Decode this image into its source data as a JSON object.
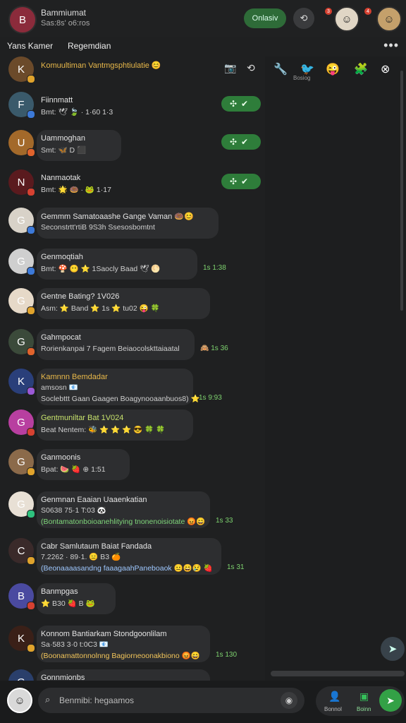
{
  "header": {
    "name": "Bammiumat",
    "subtitle": "Sas:8s' o6:ros",
    "online_label": "Onlasiv",
    "refresh_icon": "refresh-icon",
    "avatar_initial": "B"
  },
  "subbar": {
    "tab1": "Yans Kamer",
    "tab2": "Regemdian",
    "more_label": "•••"
  },
  "right_panel": {
    "label": "Bosiog"
  },
  "rows": [
    {
      "name": "Komuultiman Vantmgsphtiulatie 😊",
      "msg": "",
      "time": "",
      "name_color": "orange",
      "initial": "K",
      "avatar": "#6b4a2a",
      "badge": "#e0a32c"
    },
    {
      "name": "Fiinnmatt",
      "msg": "Bmt: 🕊 🍃  ·   1·60  1·3",
      "time": "",
      "initial": "F",
      "avatar": "#3a5a6b",
      "badge": "#3c79d8",
      "accept": true
    },
    {
      "name": "Uammoghan",
      "msg": "Smt: 🦋  D  ⬛",
      "time": "",
      "initial": "U",
      "avatar": "#a3692a",
      "badge": "#e0632c",
      "accept": true
    },
    {
      "name": "Nanmaotak",
      "msg": "Bmt: 🌟 🍩 · 🐸 1·17",
      "time": "",
      "initial": "N",
      "avatar": "#5a1a1e",
      "badge": "#d64131",
      "accept": true
    },
    {
      "name": "Gemmm Samatoaashe Gange Vaman 🍩😊",
      "msg": "Seconstrtt'rtiB 9S3h  Ssesosbomtnt",
      "time": "",
      "initial": "G",
      "avatar": "#d8d2c8",
      "badge": "#3c79d8"
    },
    {
      "name": "Genmoqtiah",
      "msg": "Bmt: 🍄 😶 ⭐ 1Saocly Baad 🕊 🌕",
      "time": "1s 1:38",
      "initial": "G",
      "avatar": "#cfcfcf",
      "badge": "#3c79d8"
    },
    {
      "name": "Gentne Bating? 1V026",
      "msg": "Asm: ⭐ Band ⭐ 1s ⭐ tu02 😜 🍀",
      "time": "",
      "initial": "G",
      "avatar": "#e6d9c8",
      "badge": "#e0a32c"
    },
    {
      "name": "Gahmpocat",
      "msg": "Rorienkanpai 7 Fagem Beiaocolskttaiaatal",
      "time": "🙈 1s 36",
      "initial": "G",
      "avatar": "#3b4a3a",
      "badge": "#e0632c"
    },
    {
      "name": "Kamnnn Bemdadar",
      "msg": "Soclebttt Gaan Gaagen Boagynooaanbuos8) ⭐",
      "time": "1s 9:93",
      "name_color": "orange",
      "initial": "K",
      "avatar": "#2a3f7a",
      "badge": "#9b59d6",
      "sub": "amsosn 📧"
    },
    {
      "name": "Gentmuniltar Bat 1V024",
      "msg": "Beat Nentem: 🐝 ⭐ ⭐ ⭐ 😎 🍀 🍀",
      "time": "",
      "name_color": "lime",
      "initial": "G",
      "avatar": "#b83fa0",
      "badge": "#d64131"
    },
    {
      "name": "Ganmoonis",
      "msg": "Bpat: 🍉 🍓 ⊕ 1:51",
      "time": "",
      "initial": "G",
      "avatar": "#8b6a4a",
      "badge": "#e0a32c"
    },
    {
      "name": "Genmnan Eaaian Uaaenkatian",
      "msg": "(Bontamatonboioanehlitying tnonenoisiotate 😡😄",
      "time": "1s 33",
      "initial": "G",
      "avatar": "#e8e0d5",
      "badge": "#2ec27e",
      "sub": "S0638 75·1 T:03 🐼",
      "msg_color": "green"
    },
    {
      "name": "Cabr Samlutaum Baiat Fandada",
      "msg": "(Beonaaaasandng faaagaahPaneboaok 😐😄😢  🍓",
      "time": "1s 31",
      "initial": "C",
      "avatar": "#3a2a2a",
      "badge": "#e0a32c",
      "sub": "7.2262 · 89·1. 😑 B3 🍊",
      "msg_color": "blue"
    },
    {
      "name": "Banmpgas",
      "msg": "⭐ B30 🍓 B 🐸",
      "time": "",
      "initial": "B",
      "avatar": "#4a4aa0",
      "badge": "#d64131"
    },
    {
      "name": "Konnom Bantiarkam Stondgoonlilam",
      "msg": "(Boonamattonnolnng Bagiorneoonakbiono 😡😄",
      "time": "1s 130",
      "initial": "K",
      "avatar": "#3a2018",
      "badge": "#e0a32c",
      "sub": "Sa·583 3·0 t:0C3 📧",
      "msg_color": "orange"
    },
    {
      "name": "Gonnmionbs",
      "msg": "",
      "time": "",
      "initial": "G",
      "avatar": "#2a3f6b",
      "badge": "#3c79d8"
    }
  ],
  "composer": {
    "placeholder": "Benmibi: hegaamos",
    "label_left": "Bonnol",
    "label_right": "Boinn"
  }
}
